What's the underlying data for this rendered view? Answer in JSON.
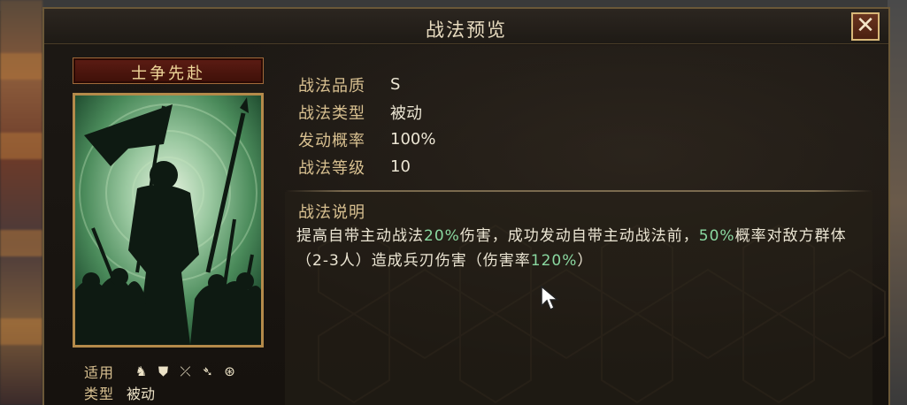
{
  "dialog": {
    "title": "战法预览",
    "close_label": "✕"
  },
  "skill": {
    "name": "士争先赴",
    "info": [
      {
        "label": "战法品质",
        "value": "S"
      },
      {
        "label": "战法类型",
        "value": "被动"
      },
      {
        "label": "发动概率",
        "value": "100%"
      },
      {
        "label": "战法等级",
        "value": "10"
      }
    ],
    "desc_title": "战法说明",
    "desc_parts": [
      {
        "text": "提高自带主动战法",
        "hl": false
      },
      {
        "text": "20%",
        "hl": true
      },
      {
        "text": "伤害，成功发动自带主动战法前，",
        "hl": false
      },
      {
        "text": "50%",
        "hl": true
      },
      {
        "text": "概率对敌方群体（2-3人）造成兵刃伤害（伤害率",
        "hl": false
      },
      {
        "text": "120%",
        "hl": true
      },
      {
        "text": "）",
        "hl": false
      }
    ]
  },
  "meta": {
    "applicable_label": "适用",
    "applicable_icons": [
      "cavalry-icon",
      "shield-icon",
      "bow-icon",
      "spear-icon",
      "siege-icon"
    ],
    "type_label": "类型",
    "type_value": "被动"
  },
  "colors": {
    "highlight": "#8ad8a0",
    "label": "#d8c090",
    "frame": "#b48a4a"
  }
}
